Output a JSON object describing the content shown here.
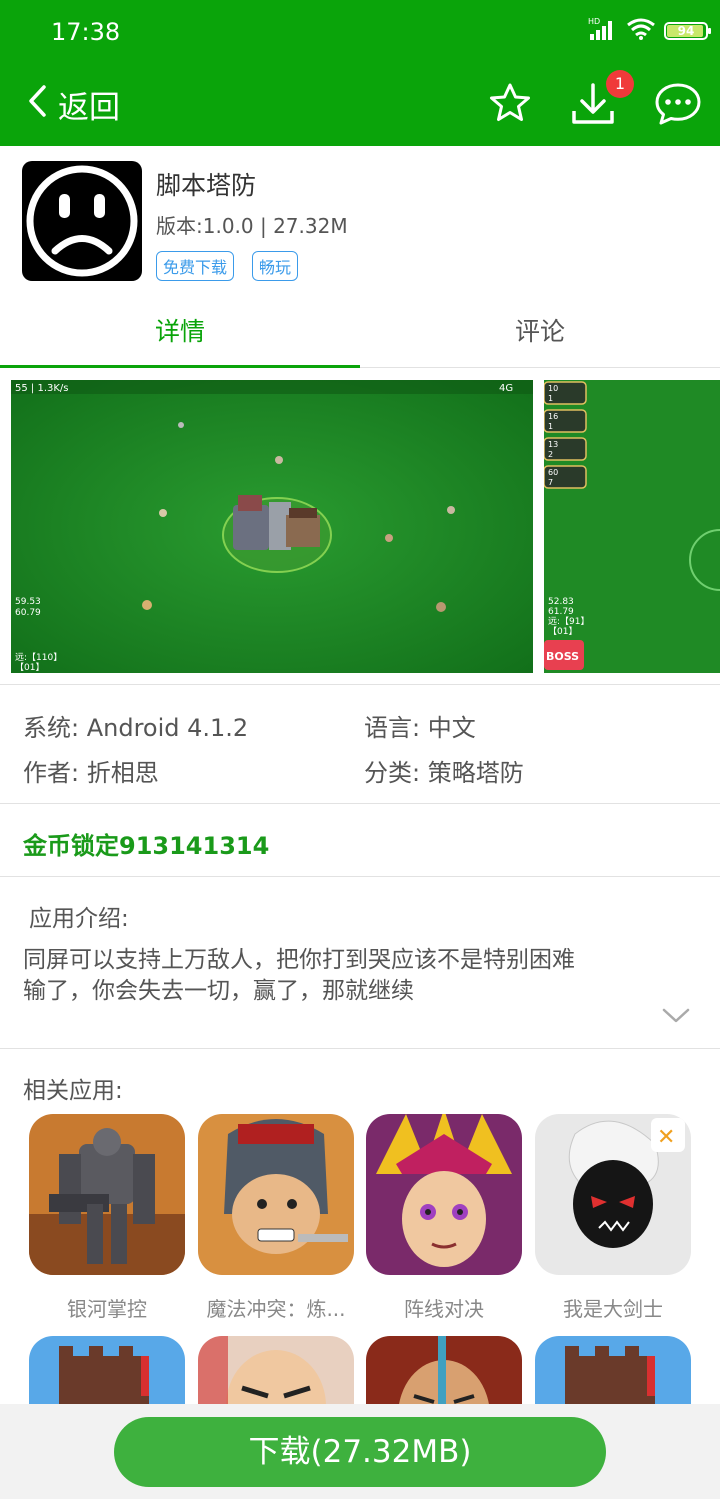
{
  "status": {
    "time": "17:38",
    "battery": "94",
    "signal_label": "HD"
  },
  "header": {
    "back_label": "返回",
    "download_badge": "1"
  },
  "app": {
    "name": "脚本塔防",
    "version_line": "版本:1.0.0 | 27.32M",
    "tags": [
      "免费下载",
      "畅玩"
    ]
  },
  "tabs": [
    "详情",
    "评论"
  ],
  "screenshots": {
    "shot1": {
      "top_left": "55 | 1.3K/s",
      "top_right": "4G",
      "stat1": "59.53",
      "stat2": "60.79",
      "stat3": "远:【110】",
      "stat4": "【01】"
    },
    "shot2": {
      "rows": [
        "10",
        "1",
        "16",
        "1",
        "13",
        "2",
        "60",
        "7"
      ],
      "stat1": "52.83",
      "stat2": "61.79",
      "stat3": "远:【91】",
      "stat4": "【01】",
      "boss": "BOSS"
    }
  },
  "specs": {
    "system": "系统: Android 4.1.2",
    "language": "语言: 中文",
    "author": "作者: 折相思",
    "category": "分类: 策略塔防"
  },
  "cheat_text": "金币锁定913141314",
  "intro": {
    "title": "应用介绍:",
    "line1": "同屏可以支持上万敌人，把你打到哭应该不是特别困难",
    "line2": "输了，你会失去一切，赢了，那就继续"
  },
  "related": {
    "title": "相关应用:",
    "items": [
      {
        "name": "银河掌控"
      },
      {
        "name": "魔法冲突：炼..."
      },
      {
        "name": "阵线对决"
      },
      {
        "name": "我是大剑士"
      }
    ]
  },
  "download_button": "下载(27.32MB)",
  "colors": {
    "brand_green": "#0aa40a",
    "button_green": "#3eb13e",
    "tag_blue": "#3b9bea",
    "badge_red": "#f03a3a"
  }
}
